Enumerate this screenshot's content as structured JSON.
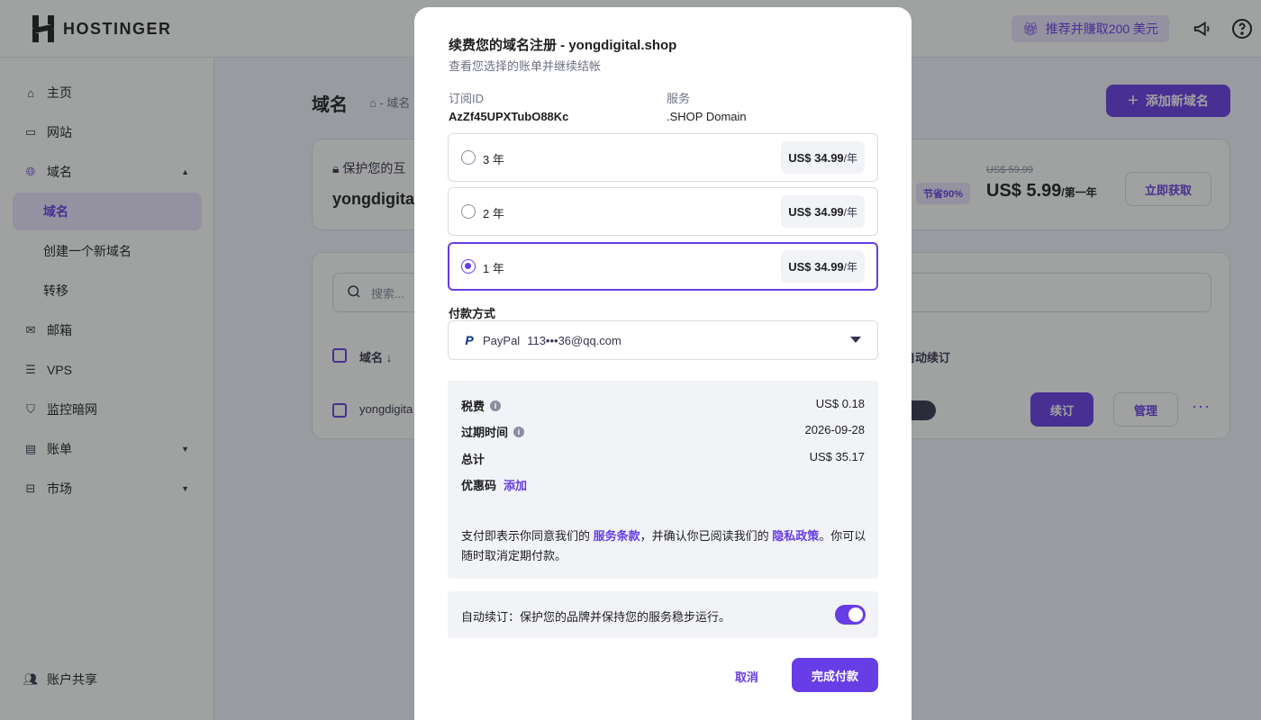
{
  "header": {
    "brand": "HOSTINGER",
    "referral_label": "推荐并赚取200 美元",
    "icons": {
      "referral": "gift-icon",
      "announce": "megaphone-icon",
      "help": "help-icon"
    }
  },
  "sidebar": {
    "items": [
      {
        "label": "主页",
        "icon": "home-icon"
      },
      {
        "label": "网站",
        "icon": "browser-icon"
      },
      {
        "label": "域名",
        "icon": "globe-icon"
      },
      {
        "label": "域名"
      },
      {
        "label": "创建一个新域名"
      },
      {
        "label": "转移"
      },
      {
        "label": "邮箱",
        "icon": "mail-icon"
      },
      {
        "label": "VPS",
        "icon": "server-icon"
      },
      {
        "label": "监控暗网",
        "icon": "shield-icon"
      },
      {
        "label": "账单",
        "icon": "card-icon"
      },
      {
        "label": "市场",
        "icon": "store-icon"
      },
      {
        "label": "账户共享",
        "icon": "users-icon"
      }
    ]
  },
  "page": {
    "title": "域名",
    "breadcrumb": "- 域名",
    "add_button": "添加新域名",
    "promo": {
      "protect_text": "保护您的互",
      "domain": "yongdigita",
      "save_badge": "节省90%",
      "old_price": "US$ 59.99",
      "new_price": "US$ 5.99",
      "per": "/第一年",
      "cta": "立即获取"
    },
    "table": {
      "search_placeholder": "搜索...",
      "col_domain": "域名 ↓",
      "col_auto": "自动续订",
      "row_domain": "yongdigita",
      "renew": "续订",
      "manage": "管理",
      "more": "···"
    }
  },
  "modal": {
    "title": "续费您的域名注册 - yongdigital.shop",
    "subtitle": "查看您选择的账单并继续结帐",
    "subscription_label": "订阅ID",
    "subscription_id": "AzZf45UPXTubO88Kc",
    "service_label": "服务",
    "service_value": ".SHOP Domain",
    "periods": [
      {
        "label": "3 年",
        "price": "US$ 34.99",
        "unit": "/年",
        "selected": false
      },
      {
        "label": "2 年",
        "price": "US$ 34.99",
        "unit": "/年",
        "selected": false
      },
      {
        "label": "1 年",
        "price": "US$ 34.99",
        "unit": "/年",
        "selected": true
      }
    ],
    "payment_label": "付款方式",
    "payment_method": "PayPal",
    "payment_account": "113•••36@qq.com",
    "summary": {
      "tax_label": "税费",
      "tax_value": "US$ 0.18",
      "expiry_label": "过期时间",
      "expiry_value": "2026-09-28",
      "total_label": "总计",
      "total_value": "US$ 35.17",
      "coupon_label": "优惠码",
      "coupon_action": "添加"
    },
    "terms": {
      "part1": "支付即表示你同意我们的 ",
      "tos_link": "服务条款",
      "part2": "，并确认你已阅读我们的 ",
      "privacy_link": "隐私政策",
      "part3": "。你可以随时取消定期付款。"
    },
    "auto_renew_text": "自动续订：保护您的品牌并保持您的服务稳步运行。",
    "auto_renew_on": true,
    "cancel": "取消",
    "pay": "完成付款"
  },
  "colors": {
    "accent": "#673de6",
    "accent_light": "#ebe4ff",
    "panel": "#f2f3f6"
  }
}
